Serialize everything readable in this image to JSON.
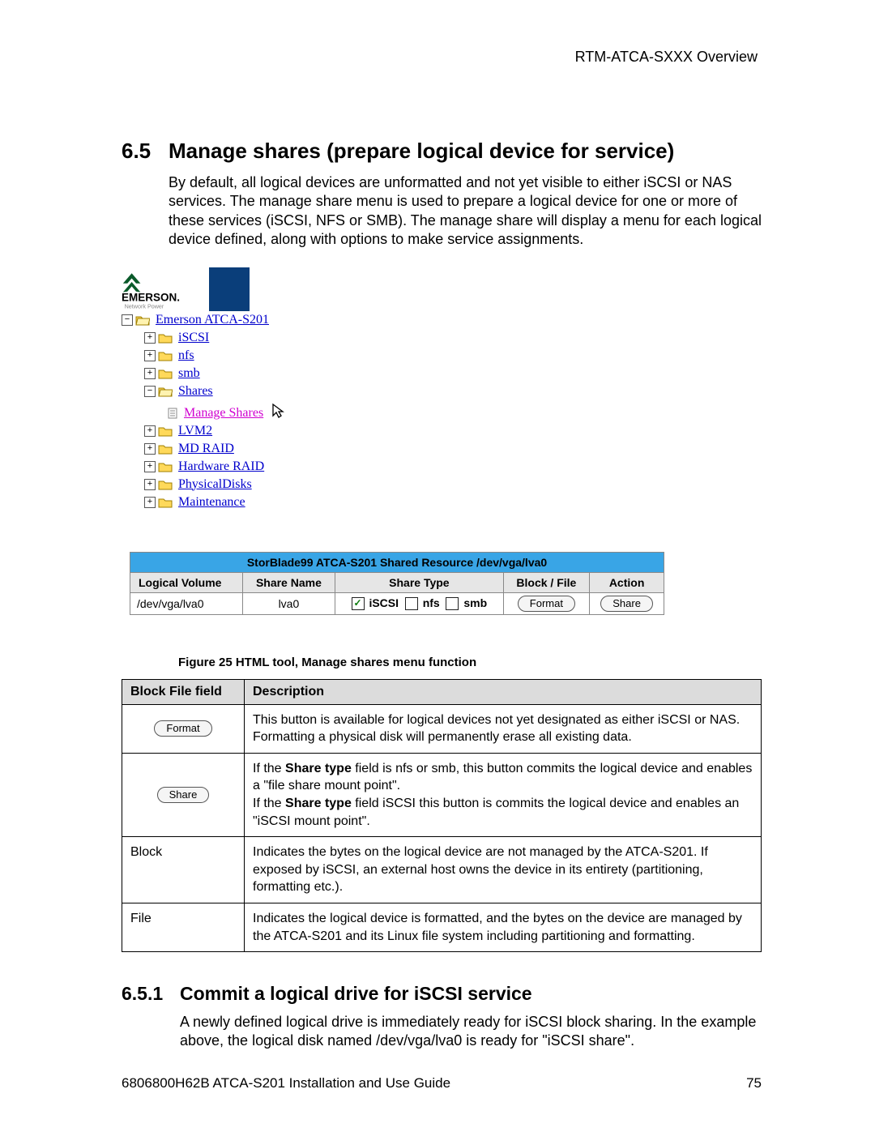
{
  "running_head": "RTM-ATCA-SXXX Overview",
  "section": {
    "num": "6.5",
    "title": "Manage shares (prepare logical device for service)",
    "para": "By default, all logical devices are unformatted and not yet visible to either iSCSI or NAS services.  The manage share menu is used to prepare a logical device for one or more of these services (iSCSI, NFS or SMB).  The manage share will display a menu for each logical device defined, along with options to make service assignments."
  },
  "tree": {
    "root": "Emerson ATCA-S201",
    "items": [
      {
        "label": "iSCSI",
        "expander": "+"
      },
      {
        "label": "nfs",
        "expander": "+"
      },
      {
        "label": "smb",
        "expander": "+"
      },
      {
        "label": "Shares",
        "expander": "−",
        "open": true,
        "children": [
          {
            "label": "Manage Shares",
            "selected": true
          }
        ]
      },
      {
        "label": "LVM2",
        "expander": "+"
      },
      {
        "label": "MD RAID",
        "expander": "+"
      },
      {
        "label": "Hardware RAID",
        "expander": "+"
      },
      {
        "label": "PhysicalDisks",
        "expander": "+"
      },
      {
        "label": "Maintenance",
        "expander": "+"
      }
    ]
  },
  "res_table": {
    "banner": "StorBlade99 ATCA-S201 Shared Resource /dev/vga/lva0",
    "headers": [
      "Logical Volume",
      "Share Name",
      "Share Type",
      "Block / File",
      "Action"
    ],
    "row": {
      "vol": "/dev/vga/lva0",
      "name": "lva0",
      "types": {
        "iscsi_label": "iSCSI",
        "nfs_label": "nfs",
        "smb_label": "smb",
        "iscsi_checked": "✓"
      },
      "blockfile_btn": "Format",
      "action_btn": "Share"
    }
  },
  "fig_caption": "Figure 25 HTML tool, Manage shares menu function",
  "desc_table": {
    "head": {
      "c1": "Block File field",
      "c2": "Description"
    },
    "rows": [
      {
        "key_btn": "Format",
        "desc": "This button is available for logical devices not yet designated as either iSCSI or NAS. Formatting a physical disk will permanently erase all existing data."
      },
      {
        "key_btn": "Share",
        "desc_pre1": "If the ",
        "desc_b1": "Share type",
        "desc_mid1": " field is nfs or smb, this button commits the logical device and enables a \"file share mount point\".",
        "desc_pre2": "If the ",
        "desc_b2": "Share type",
        "desc_mid2": " field iSCSI this button is commits the logical device and enables an \"iSCSI mount point\"."
      },
      {
        "key_text": "Block",
        "desc": "Indicates the bytes on the logical device are not managed by the ATCA-S201.  If exposed by iSCSI, an external host owns the device in its entirety (partitioning, formatting etc.)."
      },
      {
        "key_text": "File",
        "desc": "Indicates the logical device is formatted, and the bytes on the device are managed by the ATCA-S201 and its Linux file system including partitioning and formatting."
      }
    ]
  },
  "subsection": {
    "num": "6.5.1",
    "title": "Commit a logical drive for iSCSI service",
    "para": "A newly defined logical drive is immediately ready for iSCSI block sharing.  In the example above, the logical disk named /dev/vga/lva0 is ready for \"iSCSI share\"."
  },
  "footer": {
    "left": "6806800H62B ATCA-S201 Installation and Use Guide",
    "right": "75"
  }
}
